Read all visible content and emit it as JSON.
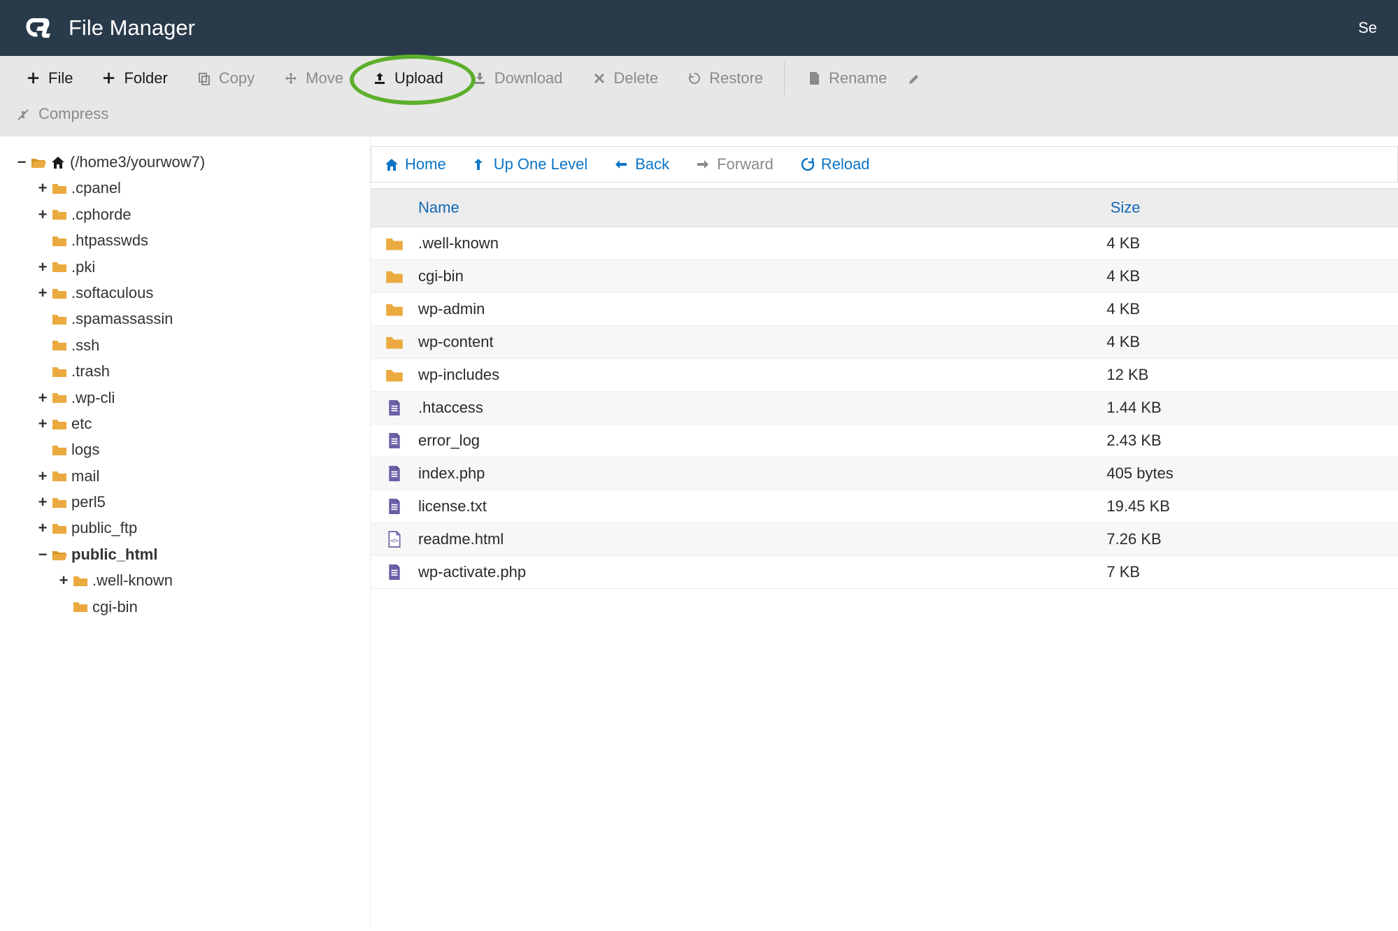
{
  "header": {
    "title": "File Manager",
    "right_partial": "Se"
  },
  "toolbar": {
    "file": "File",
    "folder": "Folder",
    "copy": "Copy",
    "move": "Move",
    "upload": "Upload",
    "download": "Download",
    "delete": "Delete",
    "restore": "Restore",
    "rename": "Rename",
    "compress": "Compress"
  },
  "tree": {
    "root_label": "(/home3/yourwow7)",
    "items": [
      {
        "toggle": "+",
        "name": ".cpanel"
      },
      {
        "toggle": "+",
        "name": ".cphorde"
      },
      {
        "toggle": "",
        "name": ".htpasswds"
      },
      {
        "toggle": "+",
        "name": ".pki"
      },
      {
        "toggle": "+",
        "name": ".softaculous"
      },
      {
        "toggle": "",
        "name": ".spamassassin"
      },
      {
        "toggle": "",
        "name": ".ssh"
      },
      {
        "toggle": "",
        "name": ".trash"
      },
      {
        "toggle": "+",
        "name": ".wp-cli"
      },
      {
        "toggle": "+",
        "name": "etc"
      },
      {
        "toggle": "",
        "name": "logs"
      },
      {
        "toggle": "+",
        "name": "mail"
      },
      {
        "toggle": "+",
        "name": "perl5"
      },
      {
        "toggle": "+",
        "name": "public_ftp"
      }
    ],
    "public_html": {
      "toggle": "−",
      "name": "public_html",
      "children": [
        {
          "toggle": "+",
          "name": ".well-known"
        },
        {
          "toggle": "",
          "name": "cgi-bin"
        }
      ]
    }
  },
  "nav": {
    "home": "Home",
    "up": "Up One Level",
    "back": "Back",
    "forward": "Forward",
    "reload": "Reload"
  },
  "table": {
    "cols": {
      "name": "Name",
      "size": "Size"
    },
    "rows": [
      {
        "type": "folder",
        "name": ".well-known",
        "size": "4 KB"
      },
      {
        "type": "folder",
        "name": "cgi-bin",
        "size": "4 KB"
      },
      {
        "type": "folder",
        "name": "wp-admin",
        "size": "4 KB"
      },
      {
        "type": "folder",
        "name": "wp-content",
        "size": "4 KB"
      },
      {
        "type": "folder",
        "name": "wp-includes",
        "size": "12 KB"
      },
      {
        "type": "file",
        "name": ".htaccess",
        "size": "1.44 KB"
      },
      {
        "type": "file",
        "name": "error_log",
        "size": "2.43 KB"
      },
      {
        "type": "file",
        "name": "index.php",
        "size": "405 bytes"
      },
      {
        "type": "file",
        "name": "license.txt",
        "size": "19.45 KB"
      },
      {
        "type": "html",
        "name": "readme.html",
        "size": "7.26 KB"
      },
      {
        "type": "file",
        "name": "wp-activate.php",
        "size": "7 KB"
      }
    ]
  }
}
